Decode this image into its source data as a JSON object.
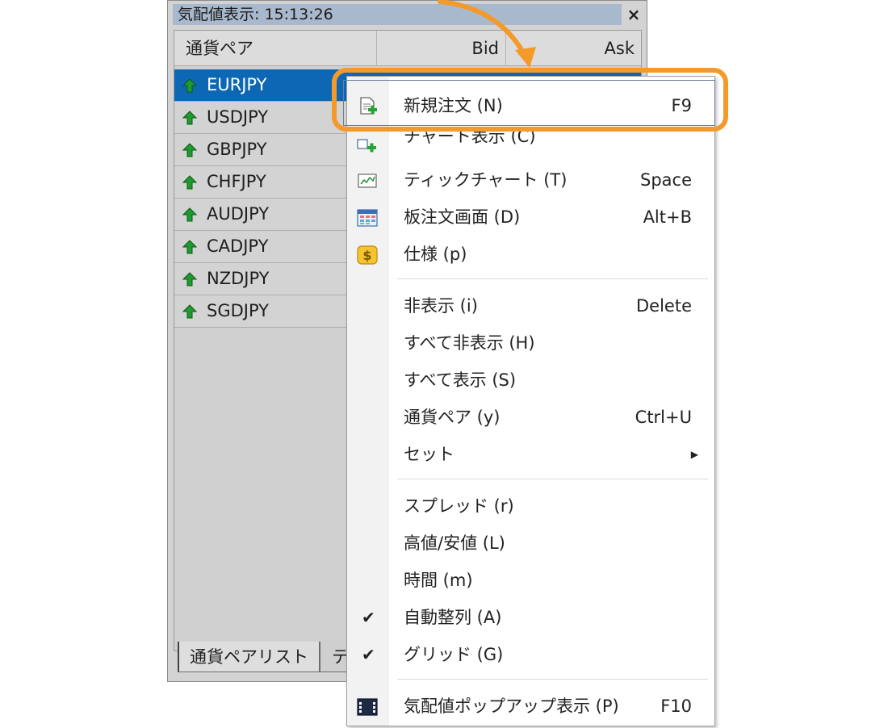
{
  "window": {
    "title": "気配値表示: 15:13:26",
    "close_label": "×",
    "columns": {
      "symbol": "通貨ペア",
      "bid": "Bid",
      "ask": "Ask"
    },
    "rows": [
      {
        "symbol": "EURJPY",
        "selected": true
      },
      {
        "symbol": "USDJPY"
      },
      {
        "symbol": "GBPJPY"
      },
      {
        "symbol": "CHFJPY"
      },
      {
        "symbol": "AUDJPY"
      },
      {
        "symbol": "CADJPY"
      },
      {
        "symbol": "NZDJPY"
      },
      {
        "symbol": "SGDJPY"
      }
    ],
    "tabs": {
      "active": "通貨ペアリスト",
      "second": "テ"
    }
  },
  "menu": {
    "new_order": {
      "label": "新規注文 (N)",
      "shortcut": "F9",
      "icon": "new-order-icon"
    },
    "chart": {
      "label": "チャート表示 (C)",
      "icon": "chart-add-icon"
    },
    "tick_chart": {
      "label": "ティックチャート (T)",
      "shortcut": "Space",
      "icon": "tick-chart-icon"
    },
    "depth": {
      "label": "板注文画面 (D)",
      "shortcut": "Alt+B",
      "icon": "depth-of-market-icon"
    },
    "spec": {
      "label": "仕様 (p)",
      "icon": "dollar-icon"
    },
    "hide": {
      "label": "非表示 (i)",
      "shortcut": "Delete"
    },
    "hide_all": {
      "label": "すべて非表示 (H)"
    },
    "show_all": {
      "label": "すべて表示 (S)"
    },
    "symbols": {
      "label": "通貨ペア (y)",
      "shortcut": "Ctrl+U"
    },
    "sets": {
      "label": "セット"
    },
    "spread": {
      "label": "スプレッド (r)"
    },
    "high_low": {
      "label": "高値/安値 (L)"
    },
    "time": {
      "label": "時間 (m)"
    },
    "auto_arrange": {
      "label": "自動整列 (A)",
      "checked": true
    },
    "grid": {
      "label": "グリッド (G)",
      "checked": true
    },
    "popup": {
      "label": "気配値ポップアップ表示 (P)",
      "shortcut": "F10",
      "icon": "popup-window-icon"
    }
  },
  "colors": {
    "highlight": "#f39a2b",
    "selection": "#0e67b4",
    "up_arrow": "#1f9a2e"
  }
}
